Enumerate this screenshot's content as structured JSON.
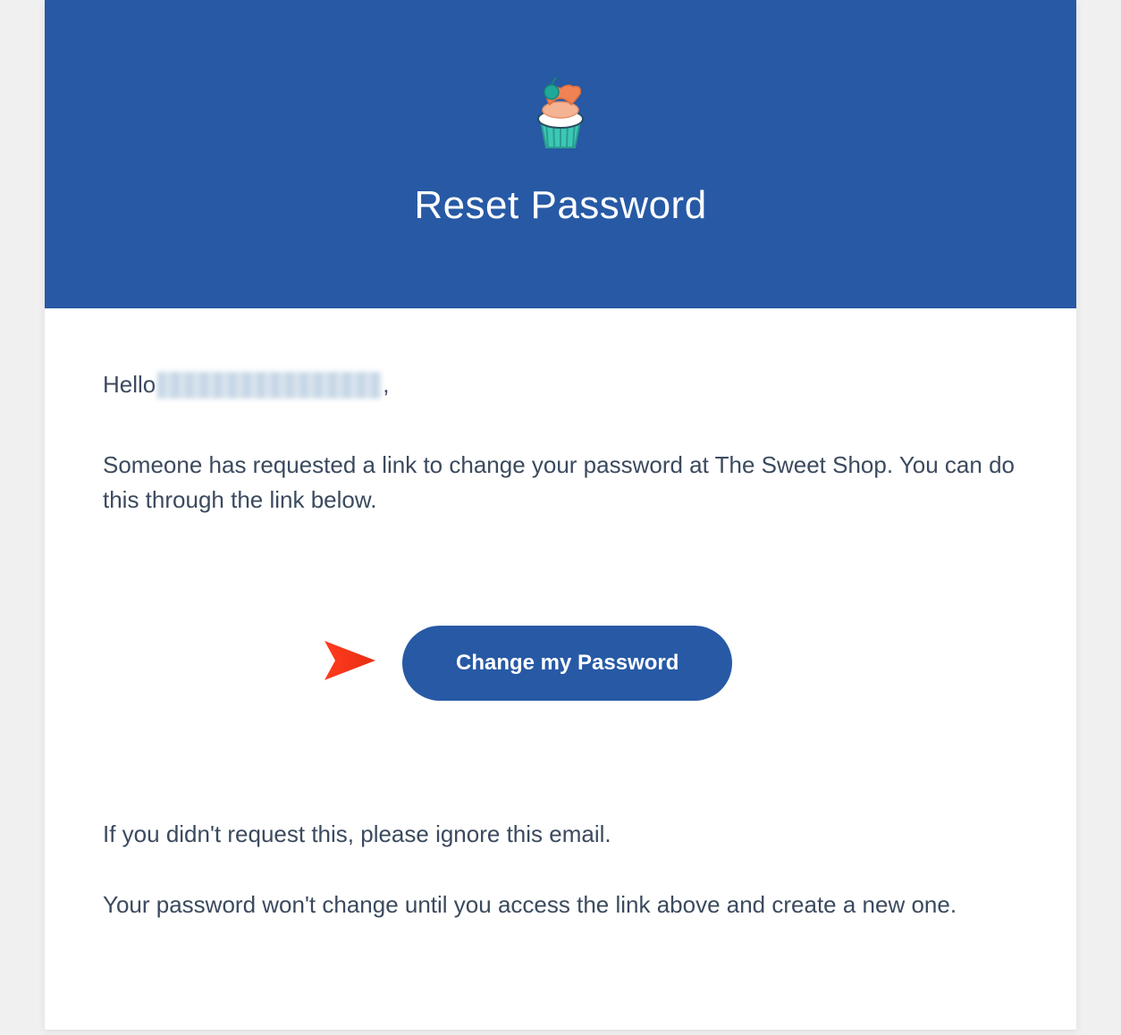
{
  "header": {
    "title": "Reset Password",
    "logo_alt": "cupcake-logo"
  },
  "greeting": {
    "prefix": "Hello ",
    "suffix": ","
  },
  "body": {
    "intro": "Someone has requested a link to change your password at The Sweet Shop. You can do this through the link below.",
    "ignore_text": "If you didn't request this, please ignore this email.",
    "no_change_text": "Your password won't change until you access the link above and create a new one."
  },
  "cta": {
    "label": "Change my Password"
  },
  "colors": {
    "brand_blue": "#2759a5",
    "text": "#3b4a5e",
    "arrow": "#ff3b1f"
  }
}
